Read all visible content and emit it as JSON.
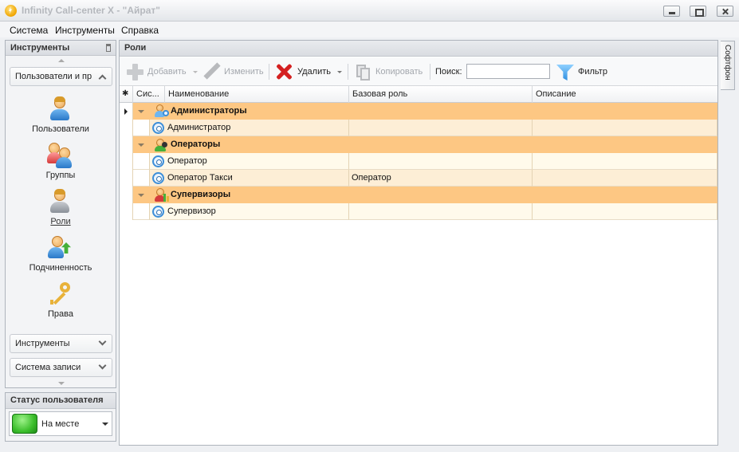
{
  "window": {
    "title": "Infinity Call-center X - \"Айрат\""
  },
  "menu": {
    "items": [
      "Система",
      "Инструменты",
      "Справка"
    ]
  },
  "left_panel": {
    "title": "Инструменты",
    "active_group": "Пользователи и пр",
    "nav": [
      {
        "label": "Пользователи",
        "icon": "user-icon"
      },
      {
        "label": "Группы",
        "icon": "users-group-icon"
      },
      {
        "label": "Роли",
        "icon": "role-icon"
      },
      {
        "label": "Подчиненность",
        "icon": "subordination-icon"
      },
      {
        "label": "Права",
        "icon": "key-icon"
      }
    ],
    "groups": [
      "Инструменты",
      "Система записи"
    ]
  },
  "status_panel": {
    "title": "Статус пользователя",
    "status": "На месте",
    "status_color": "#3cbf2c"
  },
  "roles": {
    "title": "Роли",
    "toolbar": {
      "add": "Добавить",
      "edit": "Изменить",
      "delete": "Удалить",
      "copy": "Копировать",
      "search_label": "Поиск:",
      "search_value": "",
      "filter": "Фильтр"
    },
    "columns": {
      "indicator": "✱",
      "system": "Сис...",
      "name": "Наименование",
      "base_role": "Базовая роль",
      "description": "Описание"
    },
    "groups": [
      {
        "name": "Администраторы",
        "rows": [
          {
            "name": "Администратор",
            "base_role": "",
            "description": ""
          }
        ]
      },
      {
        "name": "Операторы",
        "rows": [
          {
            "name": "Оператор",
            "base_role": "",
            "description": ""
          },
          {
            "name": "Оператор Такси",
            "base_role": "Оператор",
            "description": ""
          }
        ]
      },
      {
        "name": "Супервизоры",
        "rows": [
          {
            "name": "Супервизор",
            "base_role": "",
            "description": ""
          }
        ]
      }
    ]
  },
  "right_tab": {
    "label": "Софтфон"
  },
  "colors": {
    "group_row": "#fdc783",
    "data_row": "#fffaeb",
    "data_row_alt": "#fdeed6",
    "delete_red": "#d42020"
  }
}
